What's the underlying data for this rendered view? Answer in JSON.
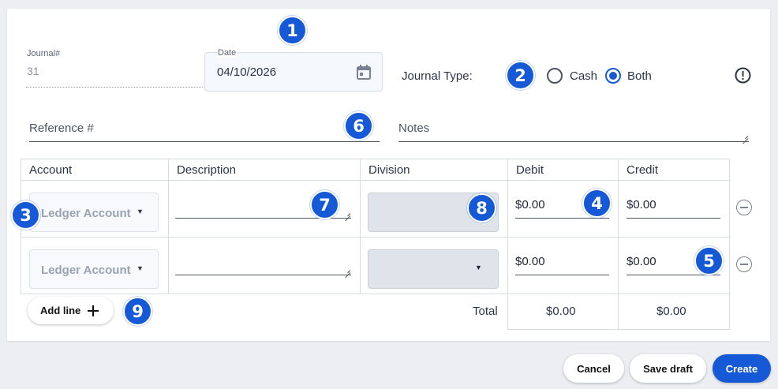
{
  "header": {
    "journal_label": "Journal#",
    "journal_value": "31",
    "date_label": "Date",
    "date_value": "04/10/2026",
    "journal_type_label": "Journal Type:",
    "journal_type_options": [
      "Cash",
      "Both"
    ],
    "journal_type_selected": "Both"
  },
  "fields": {
    "reference_placeholder": "Reference #",
    "notes_placeholder": "Notes"
  },
  "table": {
    "columns": [
      "Account",
      "Description",
      "Division",
      "Debit",
      "Credit"
    ],
    "rows": [
      {
        "account": "Ledger Account",
        "description": "",
        "debit": "$0.00",
        "credit": "$0.00"
      },
      {
        "account": "Ledger Account",
        "description": "",
        "debit": "$0.00",
        "credit": "$0.00"
      }
    ],
    "add_line_label": "Add line",
    "total_label": "Total",
    "total_debit": "$0.00",
    "total_credit": "$0.00"
  },
  "footer": {
    "cancel_label": "Cancel",
    "save_draft_label": "Save draft",
    "create_label": "Create"
  },
  "badges": [
    "1",
    "2",
    "3",
    "4",
    "5",
    "6",
    "7",
    "8",
    "9"
  ],
  "colors": {
    "accent": "#1559d6",
    "background": "#eceef2",
    "field_bg": "#f5f8fc"
  },
  "icons": [
    "calendar-icon",
    "info-icon",
    "caret-down-icon",
    "plus-icon",
    "minus-circle-icon"
  ]
}
